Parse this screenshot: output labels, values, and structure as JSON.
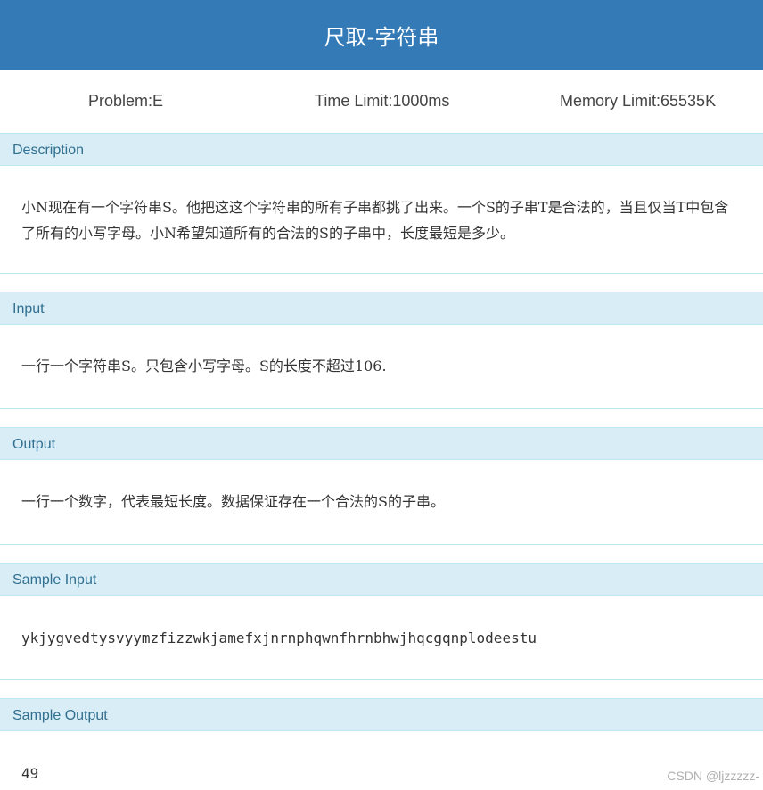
{
  "header": {
    "title": "尺取-字符串"
  },
  "meta": {
    "problem": "Problem:E",
    "time_limit": "Time Limit:1000ms",
    "memory_limit": "Memory Limit:65535K"
  },
  "sections": {
    "description": {
      "title": "Description",
      "text": "小N现在有一个字符串S。他把这这个字符串的所有子串都挑了出来。一个S的子串T是合法的，当且仅当T中包含了所有的小写字母。小N希望知道所有的合法的S的子串中，长度最短是多少。"
    },
    "input": {
      "title": "Input",
      "text": "一行一个字符串S。只包含小写字母。S的长度不超过106."
    },
    "output": {
      "title": "Output",
      "text": "一行一个数字，代表最短长度。数据保证存在一个合法的S的子串。"
    },
    "sample_input": {
      "title": "Sample Input",
      "text": "ykjygvedtysvyymzfizzwkjamefxjnrnphqwnfhrnbhwjhqcgqnplodeestu"
    },
    "sample_output": {
      "title": "Sample Output",
      "text": "49"
    }
  },
  "watermark": "CSDN @ljzzzzz-"
}
